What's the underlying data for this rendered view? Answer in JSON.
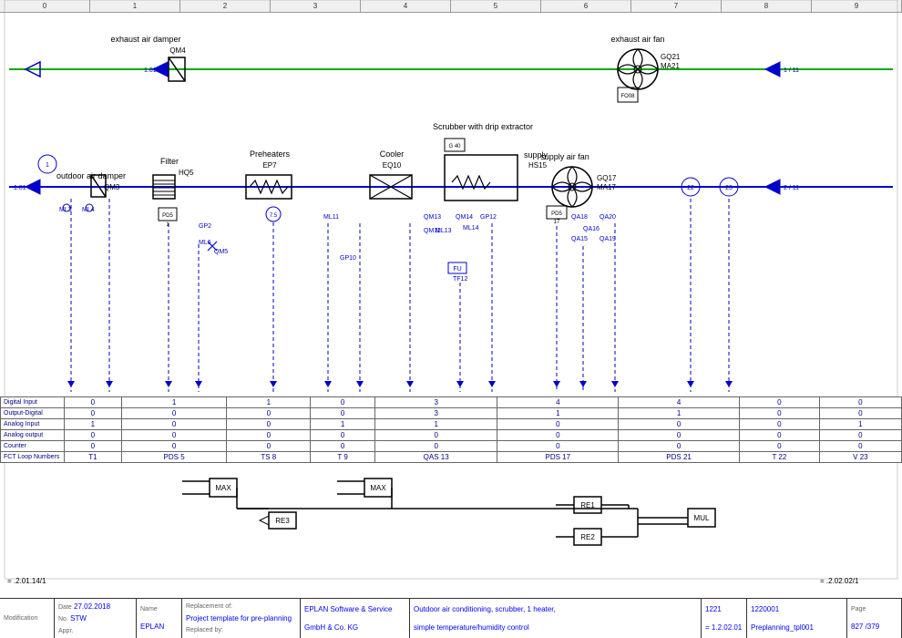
{
  "grid": {
    "columns": [
      "0",
      "1",
      "2",
      "3",
      "4",
      "5",
      "6",
      "7",
      "8",
      "9"
    ]
  },
  "diagram": {
    "title": "Preplanning_tpl001",
    "components": {
      "exhaustAirDamper": {
        "label": "exhaust air damper",
        "code": "QM4"
      },
      "exhaustAirFan": {
        "label": "exhaust air fan",
        "code": "GQ21"
      },
      "ma21": {
        "code": "MA21"
      },
      "outdoorAirDamper": {
        "label": "outdoor air damper",
        "code": "QM3"
      },
      "filter": {
        "label": "Filter",
        "code": "HQ5"
      },
      "preheaters": {
        "label": "Preheaters",
        "code": "EP7"
      },
      "cooler": {
        "label": "Cooler",
        "code": "EQ10"
      },
      "scrubber": {
        "label": "Scrubber with drip extractor"
      },
      "hs15": {
        "code": "HS15"
      },
      "supplyAirFan": {
        "label": "supply air fan"
      },
      "gq17": {
        "code": "GQ17"
      },
      "ma17": {
        "code": "MA17"
      }
    }
  },
  "ioTable": {
    "rows": [
      {
        "label": "Digital Input",
        "values": [
          "0",
          "1",
          "1",
          "0",
          "3",
          "4",
          "4",
          "0",
          "0"
        ]
      },
      {
        "label": "Output-Digital",
        "values": [
          "0",
          "0",
          "0",
          "0",
          "3",
          "1",
          "1",
          "0",
          "0"
        ]
      },
      {
        "label": "Analog Input",
        "values": [
          "1",
          "0",
          "0",
          "1",
          "1",
          "0",
          "0",
          "0",
          "1"
        ]
      },
      {
        "label": "Analog output",
        "values": [
          "0",
          "0",
          "0",
          "0",
          "0",
          "0",
          "0",
          "0",
          "0"
        ]
      },
      {
        "label": "Counter",
        "values": [
          "0",
          "0",
          "0",
          "0",
          "0",
          "0",
          "0",
          "0",
          "0"
        ]
      },
      {
        "label": "FCT Loop Numbers",
        "values": [
          "T1",
          "PDS 5",
          "TS 8",
          "T 9",
          "QAS 13",
          "PDS 17",
          "PDS 21",
          "T 22",
          "V 23"
        ]
      }
    ]
  },
  "titleBlock": {
    "modification": "Modification",
    "date_label": "Date",
    "date_val": "27.02.2018",
    "no_label": "No.",
    "no_val": "STW",
    "appr_label": "Appr.",
    "company": "EPLAN",
    "project_label": "Project template for pre-planning",
    "replacementOf": "Replacement of:",
    "replacedBy": "Replaced by:",
    "client": "EPLAN Software & Service\nGmbH & Co. KG",
    "description1": "Outdoor air conditioning, scrubber, 1 heater,",
    "description2": "simple temperature/humidity control",
    "drawingNo": "1221",
    "revision": "= 1.2.02.01",
    "docNo": "1220001",
    "filename": "Preplanning_tpl001",
    "page": "Page",
    "pageNo": "827 /379"
  }
}
